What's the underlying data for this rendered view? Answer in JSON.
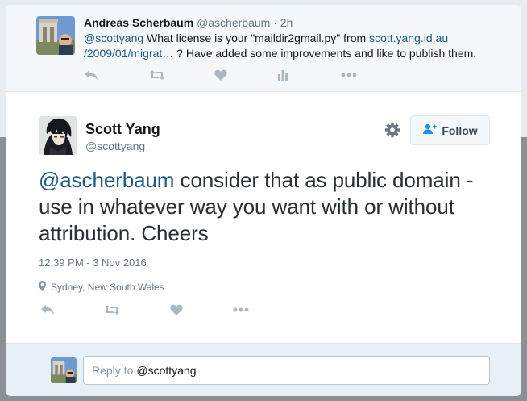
{
  "parent_tweet": {
    "author_name": "Andreas Scherbaum",
    "author_handle": "@ascherbaum",
    "separator": "·",
    "time": "2h",
    "mention": "@scottyang",
    "text_before_link": " What license is your \"maildir2gmail.py\" from ",
    "link_line1": "scott.yang.id.au",
    "link_line2": "/2009/01/migrat…",
    "text_after_link": " ? Have added some improvements and like to publish them.",
    "actions": [
      "reply-icon",
      "retweet-icon",
      "like-icon",
      "analytics-icon",
      "more-icon"
    ]
  },
  "main_tweet": {
    "author_name": "Scott Yang",
    "author_handle": "@scottyang",
    "follow_label": "Follow",
    "mention": "@ascherbaum",
    "text": " consider that as public domain - use in whatever way you want with or without attribution. Cheers",
    "timestamp": "12:39 PM - 3 Nov 2016",
    "location": "Sydney, New South Wales",
    "actions": [
      "reply-icon",
      "retweet-icon",
      "like-icon",
      "more-icon"
    ]
  },
  "reply_box": {
    "prefix": "Reply to",
    "mention": "@scottyang"
  },
  "colors": {
    "link": "#1b5b8c",
    "muted": "#657786",
    "action_icon": "#aab8c2",
    "reply_bg": "#e8f0f7"
  }
}
